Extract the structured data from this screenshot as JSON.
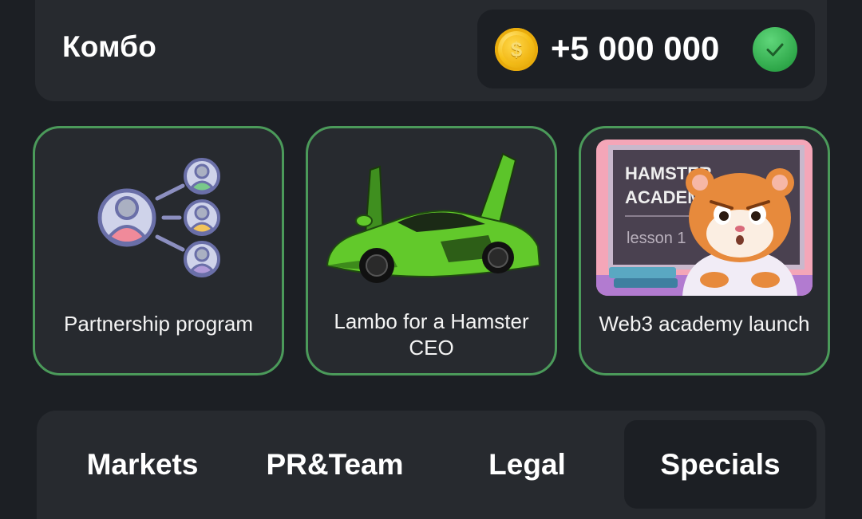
{
  "combo": {
    "title": "Комбо",
    "reward": "+5 000 000",
    "coin_symbol": "$",
    "status_icon": "check-icon",
    "accent": "#32b04c"
  },
  "cards": [
    {
      "label": "Partnership program",
      "icon": "partnership-icon"
    },
    {
      "label": "Lambo for a Hamster CEO",
      "icon": "lambo-image"
    },
    {
      "label": "Web3 academy launch",
      "icon": "hamster-academy-image",
      "board_title_1": "HAMSTER",
      "board_title_2": "ACADEMY",
      "board_subtitle": "lesson 1"
    }
  ],
  "tabs": [
    {
      "label": "Markets"
    },
    {
      "label": "PR&Team"
    },
    {
      "label": "Legal"
    },
    {
      "label": "Specials",
      "selected": true
    }
  ],
  "colors": {
    "background": "#1c1f24",
    "panel": "#272a2f",
    "card_border": "#4b9a5a"
  }
}
